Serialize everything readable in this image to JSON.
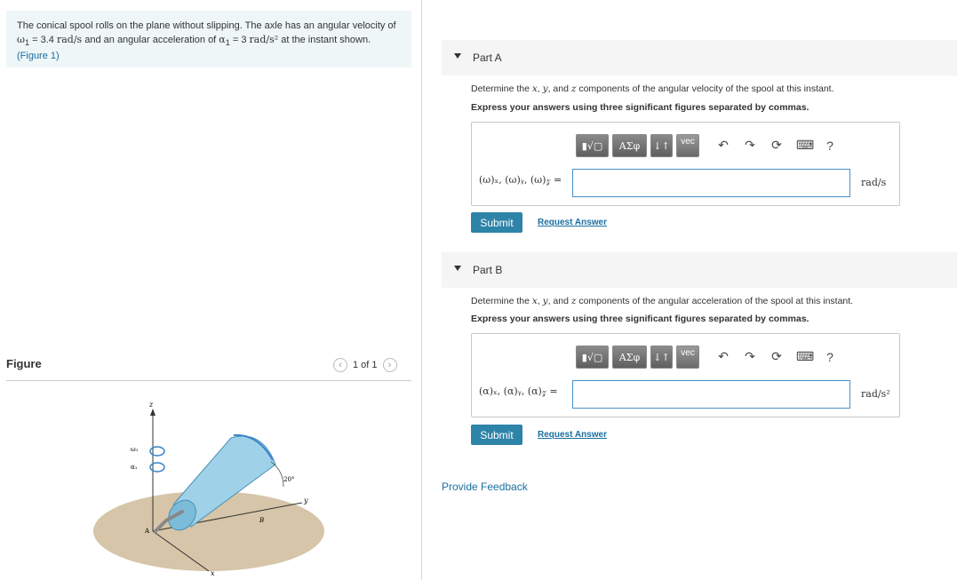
{
  "problem": {
    "line1": "The conical spool rolls on the plane without slipping. The axle has an angular velocity of",
    "omega_sym": "ω",
    "omega_sub": "1",
    "line2_eq": " = 3.4 ",
    "omega_unit": "rad/s",
    "line2_mid": " and an angular acceleration of ",
    "alpha_sym": "α",
    "alpha_sub": "1",
    "alpha_eq": " = 3 ",
    "alpha_unit": "rad/s²",
    "line2_end": " at the instant shown.",
    "figure_link": "(Figure 1)"
  },
  "figure": {
    "title": "Figure",
    "pager_text": "1 of 1",
    "labels": {
      "z": "z",
      "y": "y",
      "x": "x",
      "A": "A",
      "B": "B",
      "angle": "20°",
      "omega": "ω₁",
      "alpha": "α₁"
    },
    "colors": {
      "ground": "#d6c5a8",
      "spool": "#9fd2e8",
      "spool_dark": "#5aa7cb",
      "arrow": "#3a86c8"
    }
  },
  "partA": {
    "label": "Part A",
    "question_pre": "Determine the ",
    "x": "x",
    "sep1": ", ",
    "y": "y",
    "sep2": ", and ",
    "z": "z",
    "question_post": " components of the angular velocity of the spool at this instant.",
    "instruction": "Express your answers using three significant figures separated by commas.",
    "answer_label": "(ω)ₓ, (ω)ᵧ, (ω)𝓏 =",
    "unit": "rad/s",
    "submit": "Submit",
    "request": "Request Answer"
  },
  "partB": {
    "label": "Part B",
    "question_pre": "Determine the ",
    "x": "x",
    "sep1": ", ",
    "y": "y",
    "sep2": ", and ",
    "z": "z",
    "question_post": " components of the angular acceleration of the spool at this instant.",
    "instruction": "Express your answers using three significant figures separated by commas.",
    "answer_label": "(α)ₓ, (α)ᵧ, (α)𝓏 =",
    "unit": "rad/s²",
    "submit": "Submit",
    "request": "Request Answer"
  },
  "toolbar": {
    "templates": "▮√▢",
    "greek": "ΑΣφ",
    "arrows": "↓↑",
    "vec": "vec",
    "undo_icon": "undo-icon",
    "redo_icon": "redo-icon",
    "reset_icon": "reset-icon",
    "keyboard_icon": "keyboard-icon",
    "help": "?"
  },
  "feedback": "Provide Feedback"
}
